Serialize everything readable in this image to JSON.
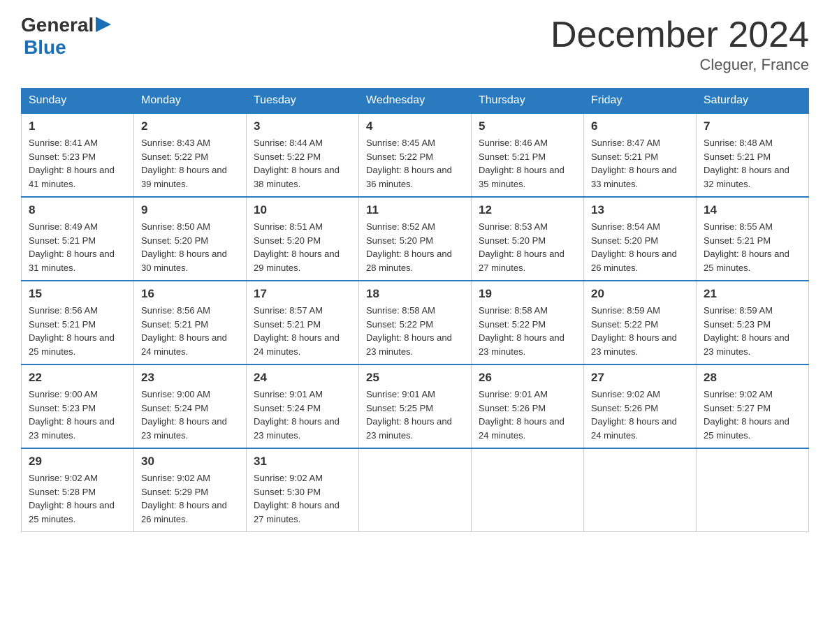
{
  "logo": {
    "general": "General",
    "arrow": "▶",
    "blue": "Blue"
  },
  "title": "December 2024",
  "subtitle": "Cleguer, France",
  "days_of_week": [
    "Sunday",
    "Monday",
    "Tuesday",
    "Wednesday",
    "Thursday",
    "Friday",
    "Saturday"
  ],
  "weeks": [
    [
      {
        "day": "1",
        "sunrise": "8:41 AM",
        "sunset": "5:23 PM",
        "daylight": "8 hours and 41 minutes."
      },
      {
        "day": "2",
        "sunrise": "8:43 AM",
        "sunset": "5:22 PM",
        "daylight": "8 hours and 39 minutes."
      },
      {
        "day": "3",
        "sunrise": "8:44 AM",
        "sunset": "5:22 PM",
        "daylight": "8 hours and 38 minutes."
      },
      {
        "day": "4",
        "sunrise": "8:45 AM",
        "sunset": "5:22 PM",
        "daylight": "8 hours and 36 minutes."
      },
      {
        "day": "5",
        "sunrise": "8:46 AM",
        "sunset": "5:21 PM",
        "daylight": "8 hours and 35 minutes."
      },
      {
        "day": "6",
        "sunrise": "8:47 AM",
        "sunset": "5:21 PM",
        "daylight": "8 hours and 33 minutes."
      },
      {
        "day": "7",
        "sunrise": "8:48 AM",
        "sunset": "5:21 PM",
        "daylight": "8 hours and 32 minutes."
      }
    ],
    [
      {
        "day": "8",
        "sunrise": "8:49 AM",
        "sunset": "5:21 PM",
        "daylight": "8 hours and 31 minutes."
      },
      {
        "day": "9",
        "sunrise": "8:50 AM",
        "sunset": "5:20 PM",
        "daylight": "8 hours and 30 minutes."
      },
      {
        "day": "10",
        "sunrise": "8:51 AM",
        "sunset": "5:20 PM",
        "daylight": "8 hours and 29 minutes."
      },
      {
        "day": "11",
        "sunrise": "8:52 AM",
        "sunset": "5:20 PM",
        "daylight": "8 hours and 28 minutes."
      },
      {
        "day": "12",
        "sunrise": "8:53 AM",
        "sunset": "5:20 PM",
        "daylight": "8 hours and 27 minutes."
      },
      {
        "day": "13",
        "sunrise": "8:54 AM",
        "sunset": "5:20 PM",
        "daylight": "8 hours and 26 minutes."
      },
      {
        "day": "14",
        "sunrise": "8:55 AM",
        "sunset": "5:21 PM",
        "daylight": "8 hours and 25 minutes."
      }
    ],
    [
      {
        "day": "15",
        "sunrise": "8:56 AM",
        "sunset": "5:21 PM",
        "daylight": "8 hours and 25 minutes."
      },
      {
        "day": "16",
        "sunrise": "8:56 AM",
        "sunset": "5:21 PM",
        "daylight": "8 hours and 24 minutes."
      },
      {
        "day": "17",
        "sunrise": "8:57 AM",
        "sunset": "5:21 PM",
        "daylight": "8 hours and 24 minutes."
      },
      {
        "day": "18",
        "sunrise": "8:58 AM",
        "sunset": "5:22 PM",
        "daylight": "8 hours and 23 minutes."
      },
      {
        "day": "19",
        "sunrise": "8:58 AM",
        "sunset": "5:22 PM",
        "daylight": "8 hours and 23 minutes."
      },
      {
        "day": "20",
        "sunrise": "8:59 AM",
        "sunset": "5:22 PM",
        "daylight": "8 hours and 23 minutes."
      },
      {
        "day": "21",
        "sunrise": "8:59 AM",
        "sunset": "5:23 PM",
        "daylight": "8 hours and 23 minutes."
      }
    ],
    [
      {
        "day": "22",
        "sunrise": "9:00 AM",
        "sunset": "5:23 PM",
        "daylight": "8 hours and 23 minutes."
      },
      {
        "day": "23",
        "sunrise": "9:00 AM",
        "sunset": "5:24 PM",
        "daylight": "8 hours and 23 minutes."
      },
      {
        "day": "24",
        "sunrise": "9:01 AM",
        "sunset": "5:24 PM",
        "daylight": "8 hours and 23 minutes."
      },
      {
        "day": "25",
        "sunrise": "9:01 AM",
        "sunset": "5:25 PM",
        "daylight": "8 hours and 23 minutes."
      },
      {
        "day": "26",
        "sunrise": "9:01 AM",
        "sunset": "5:26 PM",
        "daylight": "8 hours and 24 minutes."
      },
      {
        "day": "27",
        "sunrise": "9:02 AM",
        "sunset": "5:26 PM",
        "daylight": "8 hours and 24 minutes."
      },
      {
        "day": "28",
        "sunrise": "9:02 AM",
        "sunset": "5:27 PM",
        "daylight": "8 hours and 25 minutes."
      }
    ],
    [
      {
        "day": "29",
        "sunrise": "9:02 AM",
        "sunset": "5:28 PM",
        "daylight": "8 hours and 25 minutes."
      },
      {
        "day": "30",
        "sunrise": "9:02 AM",
        "sunset": "5:29 PM",
        "daylight": "8 hours and 26 minutes."
      },
      {
        "day": "31",
        "sunrise": "9:02 AM",
        "sunset": "5:30 PM",
        "daylight": "8 hours and 27 minutes."
      },
      null,
      null,
      null,
      null
    ]
  ]
}
